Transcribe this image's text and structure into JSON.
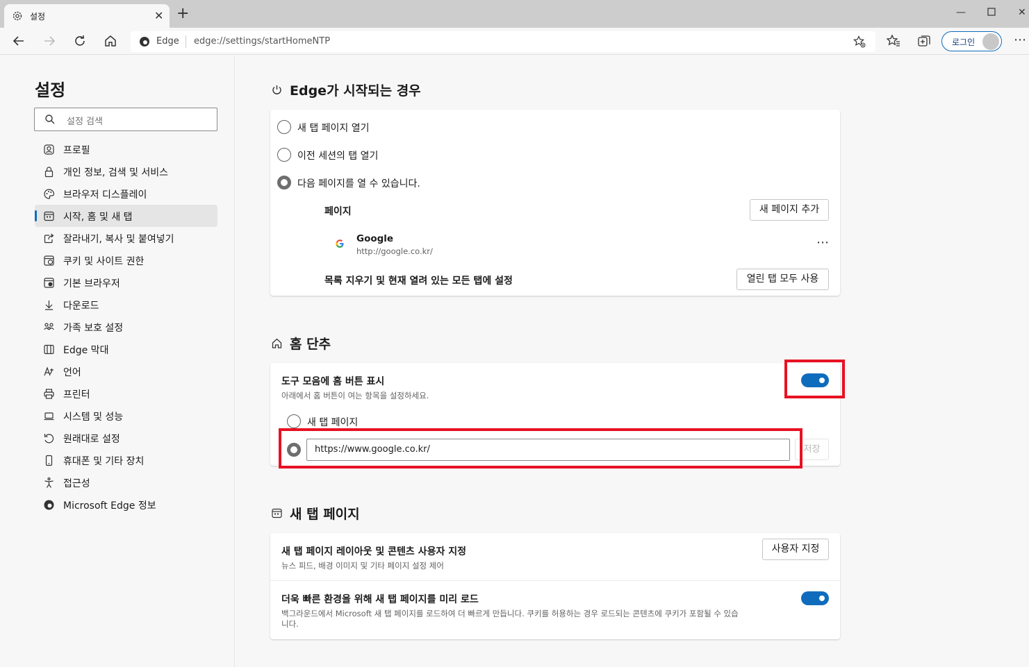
{
  "browser": {
    "tab_title": "설정",
    "address_edge": "Edge",
    "address_url": "edge://settings/startHomeNTP",
    "login_label": "로그인"
  },
  "sidebar": {
    "title": "설정",
    "search_placeholder": "설정 검색",
    "items": [
      {
        "label": "프로필",
        "icon": "profile-icon"
      },
      {
        "label": "개인 정보, 검색 및 서비스",
        "icon": "lock-icon"
      },
      {
        "label": "브라우저 디스플레이",
        "icon": "palette-icon"
      },
      {
        "label": "시작, 홈 및 새 탭",
        "icon": "start-home-icon",
        "active": true
      },
      {
        "label": "잘라내기, 복사 및 붙여넣기",
        "icon": "share-icon"
      },
      {
        "label": "쿠키 및 사이트 권한",
        "icon": "cookie-icon"
      },
      {
        "label": "기본 브라우저",
        "icon": "default-browser-icon"
      },
      {
        "label": "다운로드",
        "icon": "download-icon"
      },
      {
        "label": "가족 보호 설정",
        "icon": "family-icon"
      },
      {
        "label": "Edge 막대",
        "icon": "edge-bar-icon"
      },
      {
        "label": "언어",
        "icon": "language-icon"
      },
      {
        "label": "프린터",
        "icon": "printer-icon"
      },
      {
        "label": "시스템 및 성능",
        "icon": "laptop-icon"
      },
      {
        "label": "원래대로 설정",
        "icon": "reset-icon"
      },
      {
        "label": "휴대폰 및 기타 장치",
        "icon": "phone-icon"
      },
      {
        "label": "접근성",
        "icon": "accessibility-icon"
      },
      {
        "label": "Microsoft Edge 정보",
        "icon": "edge-logo-icon"
      }
    ]
  },
  "startup": {
    "heading": "Edge가 시작되는 경우",
    "options": [
      "새 탭 페이지 열기",
      "이전 세션의 탭 열기",
      "다음 페이지를 열 수 있습니다."
    ],
    "selected_option": 2,
    "pages_label": "페이지",
    "add_page_button": "새 페이지 추가",
    "page_name": "Google",
    "page_url": "http://google.co.kr/",
    "clear_label": "목록 지우기 및 현재 열려 있는 모든 탭에 설정",
    "use_all_tabs_button": "열린 탭 모두 사용"
  },
  "home": {
    "heading": "홈 단추",
    "show_home_label": "도구 모음에 홈 버튼 표시",
    "show_home_desc": "아래에서 홈 버튼이 여는 항목을 설정하세요.",
    "show_home_on": true,
    "option_newtab": "새 탭 페이지",
    "url_value": "https://www.google.co.kr/",
    "save_button": "저장"
  },
  "newtab": {
    "heading": "새 탭 페이지",
    "customize_label": "새 탭 페이지 레이아웃 및 콘텐츠 사용자 지정",
    "customize_desc": "뉴스 피드, 배경 이미지 및 기타 페이지 설정 제어",
    "customize_button": "사용자 지정",
    "preload_label": "더욱 빠른 환경을 위해 새 탭 페이지를 미리 로드",
    "preload_desc_1": "백그라운드에서 Microsoft 새 탭 페이지를 로드하여 더 빠르게 만듭니다. 쿠키를 허용하는 경우 로드되는 콘텐츠에 쿠키가 포함될 수 있습",
    "preload_desc_2": "니다.",
    "preload_on": true
  },
  "colors": {
    "accent": "#0f6cbd",
    "highlight": "#e81123"
  }
}
